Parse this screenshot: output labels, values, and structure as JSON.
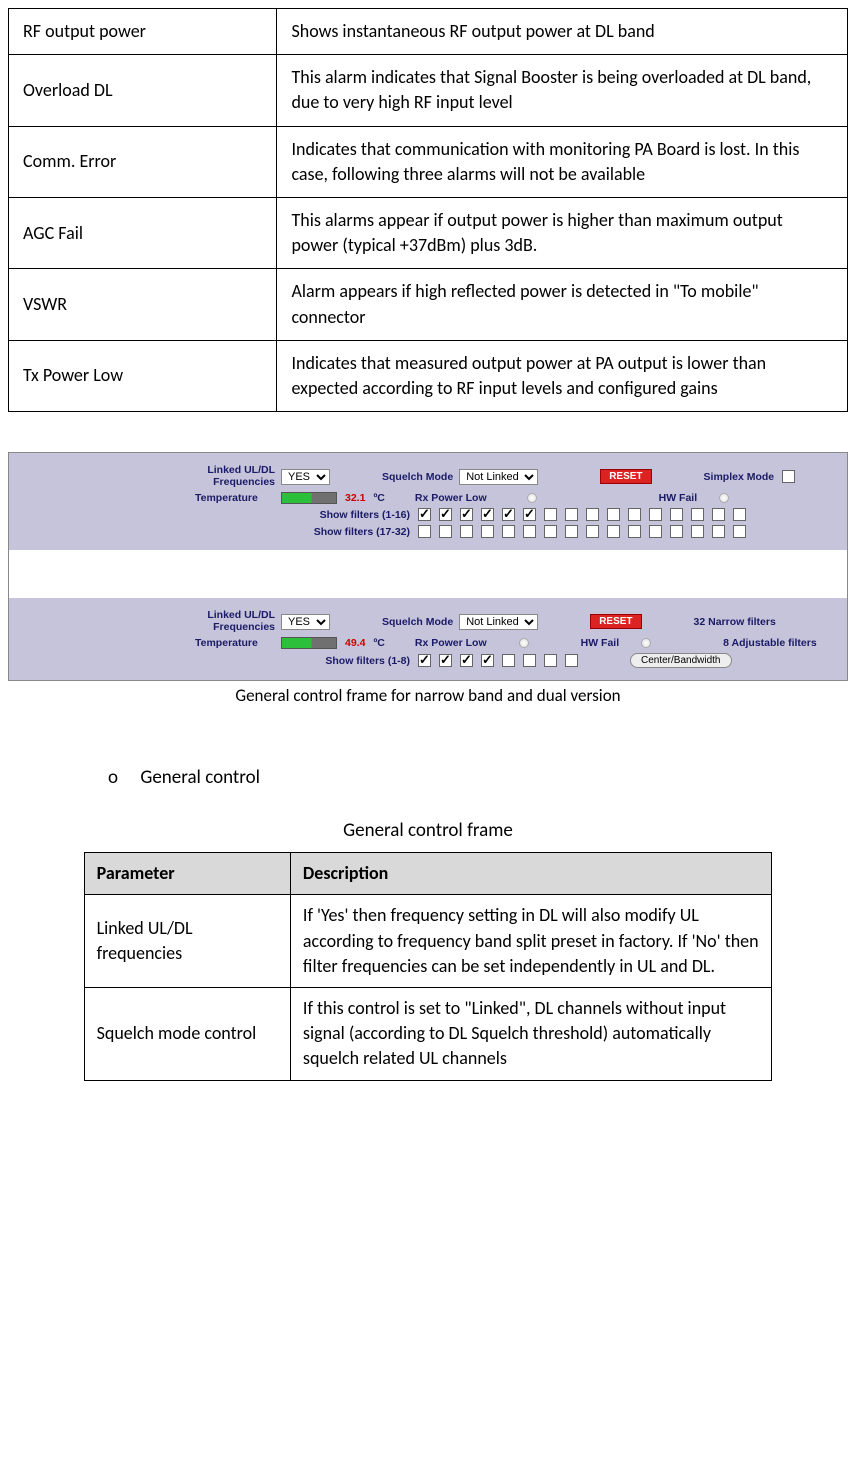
{
  "table1_rows": [
    {
      "param": "RF output power",
      "desc": "Shows instantaneous RF output power at DL band"
    },
    {
      "param": "Overload DL",
      "desc": "This alarm indicates that Signal Booster is being overloaded at DL band, due to very high RF input level"
    },
    {
      "param": "Comm. Error",
      "desc": "Indicates that communication with monitoring PA Board is lost. In this case, following three alarms will not be available"
    },
    {
      "param": "AGC Fail",
      "desc": "This alarms appear if output power is higher than maximum output power (typical +37dBm) plus 3dB."
    },
    {
      "param": "VSWR",
      "desc": "Alarm appears if high reflected power is detected in \"To mobile\" connector"
    },
    {
      "param": "Tx Power Low",
      "desc": "Indicates that measured output power at PA output is lower than expected according to RF input levels and configured gains"
    }
  ],
  "panelA": {
    "linked_label": "Linked UL/DL\nFrequencies",
    "linked_value": "YES",
    "squelch_label": "Squelch Mode",
    "squelch_value": "Not Linked",
    "reset_label": "RESET",
    "simplex_label": "Simplex Mode",
    "temperature_label": "Temperature",
    "temperature_value": "32.1",
    "temperature_unit": "ºC",
    "rx_power_low_label": "Rx Power Low",
    "hw_fail_label": "HW Fail",
    "show_1_16_label": "Show filters (1-16)",
    "show_17_32_label": "Show filters (17-32)",
    "filters_1_16": [
      true,
      true,
      true,
      true,
      true,
      true,
      false,
      false,
      false,
      false,
      false,
      false,
      false,
      false,
      false,
      false
    ],
    "filters_17_32": [
      false,
      false,
      false,
      false,
      false,
      false,
      false,
      false,
      false,
      false,
      false,
      false,
      false,
      false,
      false,
      false
    ]
  },
  "panelB": {
    "linked_label": "Linked UL/DL\nFrequencies",
    "linked_value": "YES",
    "squelch_label": "Squelch Mode",
    "squelch_value": "Not Linked",
    "reset_label": "RESET",
    "narrow_label": "32 Narrow filters",
    "adjustable_label": "8 Adjustable filters",
    "temperature_label": "Temperature",
    "temperature_value": "49.4",
    "temperature_unit": "ºC",
    "rx_power_low_label": "Rx Power Low",
    "hw_fail_label": "HW Fail",
    "show_1_8_label": "Show filters (1-8)",
    "filters_1_8": [
      true,
      true,
      true,
      true,
      false,
      false,
      false,
      false
    ],
    "cbw_label": "Center/Bandwidth"
  },
  "caption": "General control frame for narrow band and dual version",
  "bullet_o": "o",
  "bullet_text": "General control",
  "frame_title": "General control frame",
  "table2_headers": {
    "param": "Parameter",
    "desc": "Description"
  },
  "table2_rows": [
    {
      "param": "Linked UL/DL frequencies",
      "desc": "If 'Yes' then frequency setting in DL will also modify UL according to frequency band split preset in factory. If 'No' then filter frequencies can be set independently in UL and DL."
    },
    {
      "param": "Squelch mode control",
      "desc": "If this control is set to \"Linked\", DL channels without input signal (according to DL Squelch threshold) automatically squelch related UL channels"
    }
  ]
}
